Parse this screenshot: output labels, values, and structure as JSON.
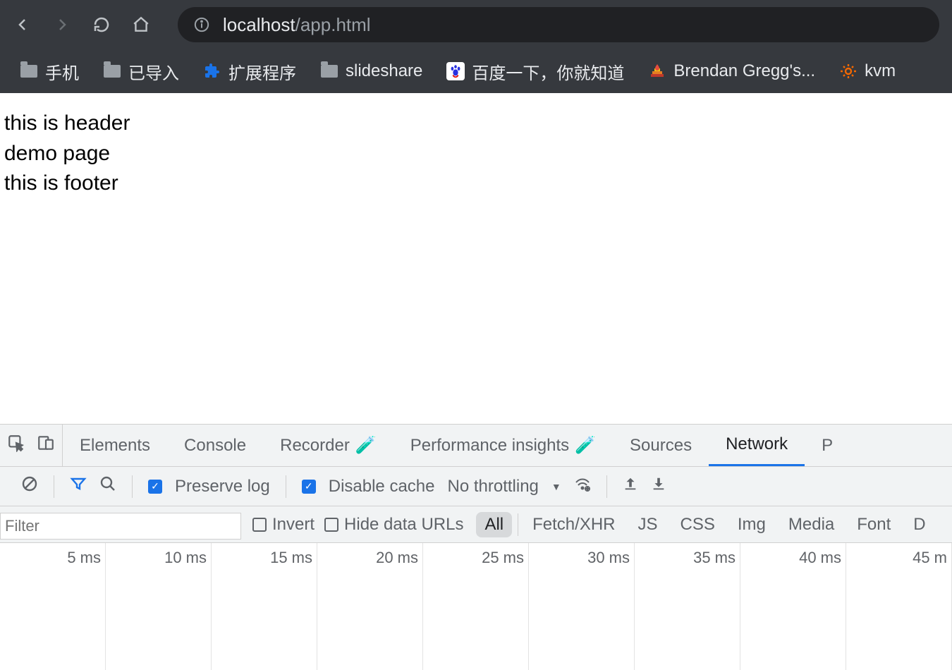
{
  "browser": {
    "url_host": "localhost",
    "url_path": "/app.html",
    "bookmarks": [
      {
        "label": "手机",
        "icon": "folder"
      },
      {
        "label": "已导入",
        "icon": "folder"
      },
      {
        "label": "扩展程序",
        "icon": "puzzle"
      },
      {
        "label": "slideshare",
        "icon": "folder"
      },
      {
        "label": "百度一下，你就知道",
        "icon": "baidu"
      },
      {
        "label": "Brendan Gregg's...",
        "icon": "flame"
      },
      {
        "label": "kvm",
        "icon": "grafana"
      }
    ]
  },
  "page": {
    "line1": "this is header",
    "line2": "demo page",
    "line3": "this is footer"
  },
  "devtools": {
    "tabs": [
      "Elements",
      "Console",
      "Recorder",
      "Performance insights",
      "Sources",
      "Network",
      "P"
    ],
    "active_tab": "Network",
    "controls": {
      "preserve_log": "Preserve log",
      "disable_cache": "Disable cache",
      "throttling": "No throttling"
    },
    "filter": {
      "placeholder": "Filter",
      "invert": "Invert",
      "hide": "Hide data URLs",
      "chips": [
        "All",
        "Fetch/XHR",
        "JS",
        "CSS",
        "Img",
        "Media",
        "Font",
        "D"
      ]
    },
    "timeline": [
      "5 ms",
      "10 ms",
      "15 ms",
      "20 ms",
      "25 ms",
      "30 ms",
      "35 ms",
      "40 ms",
      "45 m"
    ]
  }
}
